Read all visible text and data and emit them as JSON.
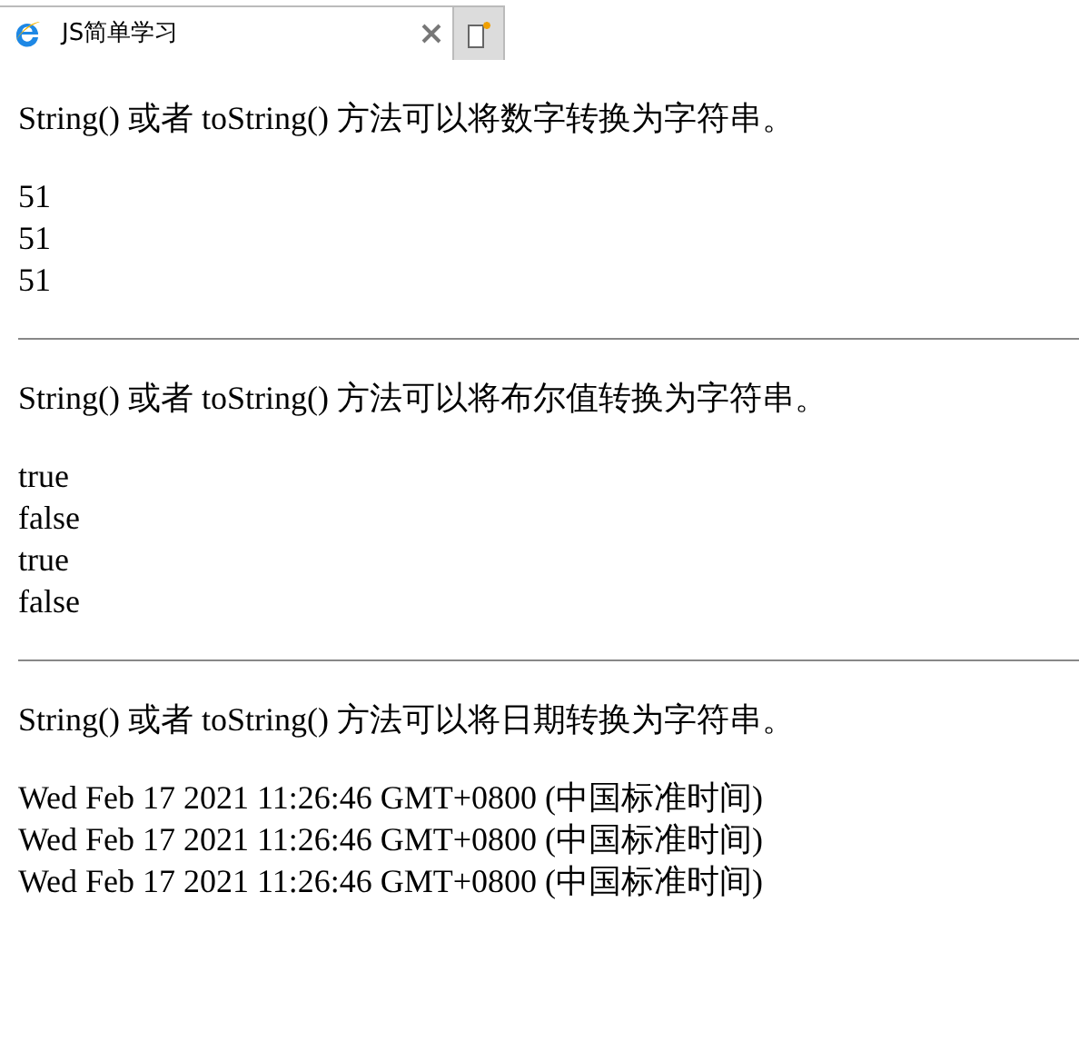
{
  "tab": {
    "title": "JS简单学习"
  },
  "sections": [
    {
      "heading": "String() 或者 toString() 方法可以将数字转换为字符串。",
      "lines": [
        "51",
        "51",
        "51"
      ]
    },
    {
      "heading": "String() 或者 toString() 方法可以将布尔值转换为字符串。",
      "lines": [
        "true",
        "false",
        "true",
        "false"
      ]
    },
    {
      "heading": "String() 或者 toString() 方法可以将日期转换为字符串。",
      "lines": [
        "Wed Feb 17 2021 11:26:46 GMT+0800 (中国标准时间)",
        "Wed Feb 17 2021 11:26:46 GMT+0800 (中国标准时间)",
        "Wed Feb 17 2021 11:26:46 GMT+0800 (中国标准时间)"
      ]
    }
  ]
}
